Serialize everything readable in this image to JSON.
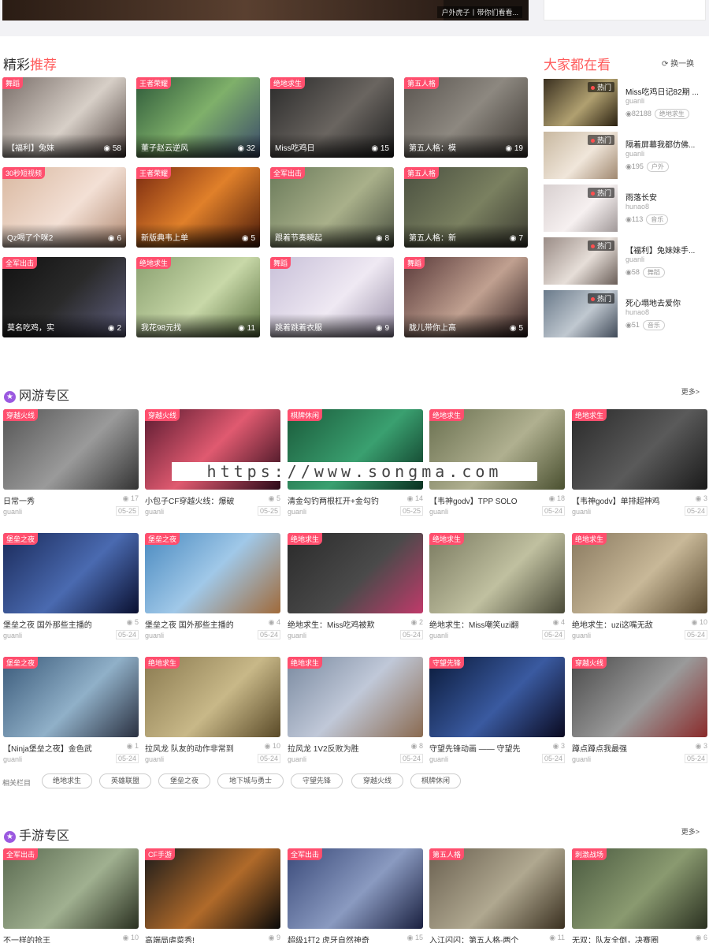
{
  "top": {
    "caption": "户外虎子丨带你们看看..."
  },
  "recommend": {
    "title_prefix": "精彩",
    "title_highlight": "推荐",
    "cards": [
      {
        "tag": "舞蹈",
        "title": "【福利】兔妹",
        "views": "58"
      },
      {
        "tag": "王者荣耀",
        "title": "董子赵云逆风",
        "views": "32"
      },
      {
        "tag": "绝地求生",
        "title": "Miss吃鸡日",
        "views": "15"
      },
      {
        "tag": "第五人格",
        "title": "第五人格：模",
        "views": "19"
      },
      {
        "tag": "30秒短视频",
        "title": "Qz喝了个咪2",
        "views": "6"
      },
      {
        "tag": "王者荣耀",
        "title": "新版典韦上单",
        "views": "5"
      },
      {
        "tag": "全军出击",
        "title": "跟着节奏瞬起",
        "views": "8"
      },
      {
        "tag": "第五人格",
        "title": "第五人格：新",
        "views": "7"
      },
      {
        "tag": "全军出击",
        "title": "莫名吃鸡，实",
        "views": "2"
      },
      {
        "tag": "绝地求生",
        "title": "我花98元找",
        "views": "11"
      },
      {
        "tag": "舞蹈",
        "title": "跳着跳着衣服",
        "views": "9"
      },
      {
        "tag": "舞蹈",
        "title": "胧儿带你上高",
        "views": "5"
      }
    ]
  },
  "hot": {
    "title": "大家都在看",
    "swap_label": "换一换",
    "badge": "热门",
    "items": [
      {
        "title": "Miss吃鸡日记82期 ...",
        "author": "guanli",
        "views": "82188",
        "tag": "绝地求生"
      },
      {
        "title": "隔着屏幕我都仿佛...",
        "author": "guanli",
        "views": "195",
        "tag": "户外"
      },
      {
        "title": "雨落长安",
        "author": "hunao8",
        "views": "113",
        "tag": "音乐"
      },
      {
        "title": "【福利】兔妹妹手...",
        "author": "guanli",
        "views": "58",
        "tag": "舞蹈"
      },
      {
        "title": "死心塌地去爱你",
        "author": "hunao8",
        "views": "51",
        "tag": "音乐"
      }
    ]
  },
  "zone_online": {
    "title": "网游专区",
    "more": "更多>",
    "related_label": "相关栏目",
    "related_tags": [
      "绝地求生",
      "英雄联盟",
      "堡垒之夜",
      "地下城与勇士",
      "守望先锋",
      "穿越火线",
      "棋牌休闲"
    ],
    "cards": [
      {
        "tag": "穿越火线",
        "title": "日常一秀",
        "views": "17",
        "user": "guanli",
        "date": "05-25"
      },
      {
        "tag": "穿越火线",
        "title": "小包子CF穿越火线：爆破",
        "views": "5",
        "user": "guanli",
        "date": "05-25"
      },
      {
        "tag": "棋牌休闲",
        "title": "清金勾钓两根杠开+金勾钓",
        "views": "14",
        "user": "guanli",
        "date": "05-25"
      },
      {
        "tag": "绝地求生",
        "title": "【韦神godv】TPP SOLO",
        "views": "18",
        "user": "guanli",
        "date": "05-24"
      },
      {
        "tag": "绝地求生",
        "title": "【韦神godv】单排超神鸡",
        "views": "3",
        "user": "guanli",
        "date": "05-24"
      },
      {
        "tag": "堡垒之夜",
        "title": "堡垒之夜 国外那些主播的",
        "views": "5",
        "user": "guanli",
        "date": "05-24"
      },
      {
        "tag": "堡垒之夜",
        "title": "堡垒之夜 国外那些主播的",
        "views": "4",
        "user": "guanli",
        "date": "05-24"
      },
      {
        "tag": "绝地求生",
        "title": "绝地求生：Miss吃鸡被欺",
        "views": "2",
        "user": "guanli",
        "date": "05-24"
      },
      {
        "tag": "绝地求生",
        "title": "绝地求生：Miss嘲笑uzi翻",
        "views": "4",
        "user": "guanli",
        "date": "05-24"
      },
      {
        "tag": "绝地求生",
        "title": "绝地求生：uzi这嘴无敌",
        "views": "10",
        "user": "guanli",
        "date": "05-24"
      },
      {
        "tag": "堡垒之夜",
        "title": "【Ninja堡垒之夜】金色武",
        "views": "1",
        "user": "guanli",
        "date": "05-24"
      },
      {
        "tag": "绝地求生",
        "title": "拉风龙 队友的动作非常到",
        "views": "10",
        "user": "guanli",
        "date": "05-24"
      },
      {
        "tag": "绝地求生",
        "title": "拉风龙 1V2反败为胜",
        "views": "8",
        "user": "guanli",
        "date": "05-24"
      },
      {
        "tag": "守望先锋",
        "title": "守望先锋动画 —— 守望先",
        "views": "3",
        "user": "guanli",
        "date": "05-24"
      },
      {
        "tag": "穿越火线",
        "title": "蹲点蹲点我最强",
        "views": "3",
        "user": "guanli",
        "date": "05-24"
      }
    ]
  },
  "zone_mobile": {
    "title": "手游专区",
    "more": "更多>",
    "cards": [
      {
        "tag": "全军出击",
        "title": "不一样的抢王",
        "views": "10"
      },
      {
        "tag": "CF手游",
        "title": "高端局虐菜秀!",
        "views": "9"
      },
      {
        "tag": "全军出击",
        "title": "超级1打2 虎牙自然神奇",
        "views": "15"
      },
      {
        "tag": "第五人格",
        "title": "入江闪闪：第五人格-两个",
        "views": "11"
      },
      {
        "tag": "刺激战场",
        "title": "无双：队友全倒，决赛圈",
        "views": "6"
      }
    ]
  },
  "watermark": "https://www.songma.com"
}
